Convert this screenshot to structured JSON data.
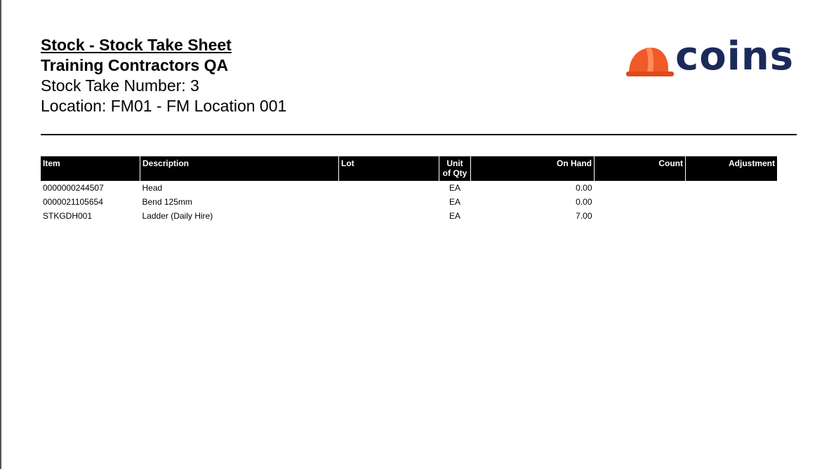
{
  "report": {
    "title": "Stock - Stock Take Sheet",
    "company": "Training Contractors QA",
    "stock_take_number": "Stock Take Number: 3",
    "location": "Location: FM01 - FM Location 001"
  },
  "logo": {
    "text": "coins",
    "helmet_color": "#f05a28",
    "text_color": "#1b2a5a"
  },
  "table": {
    "headers": {
      "item": "Item",
      "description": "Description",
      "lot": "Lot",
      "unit_line1": "Unit",
      "unit_line2": "of Qty",
      "on_hand": "On Hand",
      "count": "Count",
      "adjustment": "Adjustment"
    },
    "rows": [
      {
        "item": "0000000244507",
        "description": "Head",
        "lot": "",
        "unit": "EA",
        "on_hand": "0.00",
        "count": "",
        "adjustment": ""
      },
      {
        "item": "0000021105654",
        "description": "Bend 125mm",
        "lot": "",
        "unit": "EA",
        "on_hand": "0.00",
        "count": "",
        "adjustment": ""
      },
      {
        "item": "STKGDH001",
        "description": "Ladder (Daily Hire)",
        "lot": "",
        "unit": "EA",
        "on_hand": "7.00",
        "count": "",
        "adjustment": ""
      }
    ]
  }
}
